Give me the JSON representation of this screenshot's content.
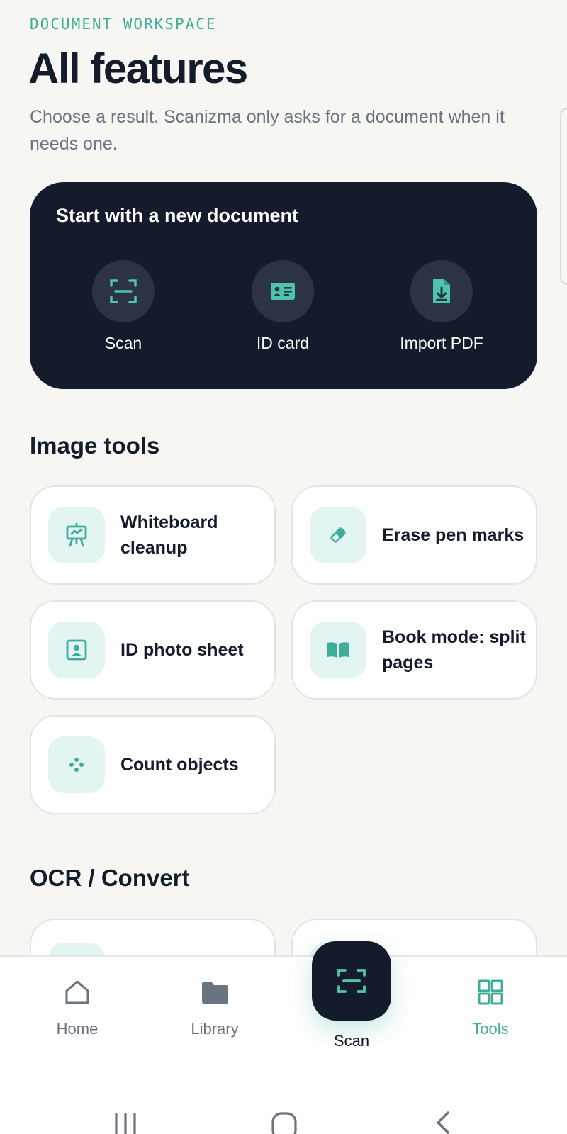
{
  "header": {
    "eyebrow": "DOCUMENT WORKSPACE",
    "title": "All features",
    "subtitle": "Choose a result. Scanizma only asks for a document when it needs one."
  },
  "start_card": {
    "title": "Start with a new document",
    "actions": [
      {
        "label": "Scan",
        "icon": "scan-icon"
      },
      {
        "label": "ID card",
        "icon": "id-card-icon"
      },
      {
        "label": "Import PDF",
        "icon": "import-pdf-icon"
      }
    ]
  },
  "image_tools": {
    "title": "Image tools",
    "items": [
      {
        "label": "Whiteboard cleanup",
        "icon": "whiteboard-icon"
      },
      {
        "label": "Erase pen marks",
        "icon": "eraser-icon"
      },
      {
        "label": "ID photo sheet",
        "icon": "id-photo-icon"
      },
      {
        "label": "Book mode: split pages",
        "icon": "book-icon"
      },
      {
        "label": "Count objects",
        "icon": "dots-icon"
      }
    ]
  },
  "ocr_section": {
    "title": "OCR / Convert"
  },
  "bottom_nav": {
    "items": [
      {
        "label": "Home",
        "icon": "home-icon"
      },
      {
        "label": "Library",
        "icon": "folder-icon"
      },
      {
        "label": "Scan",
        "icon": "scan-icon"
      },
      {
        "label": "Tools",
        "icon": "grid-icon"
      }
    ],
    "active": "Tools"
  },
  "colors": {
    "accent": "#3fae98",
    "dark_card": "#141b2c",
    "background": "#f6f6f3",
    "icon_tile": "#e3f5f2"
  }
}
